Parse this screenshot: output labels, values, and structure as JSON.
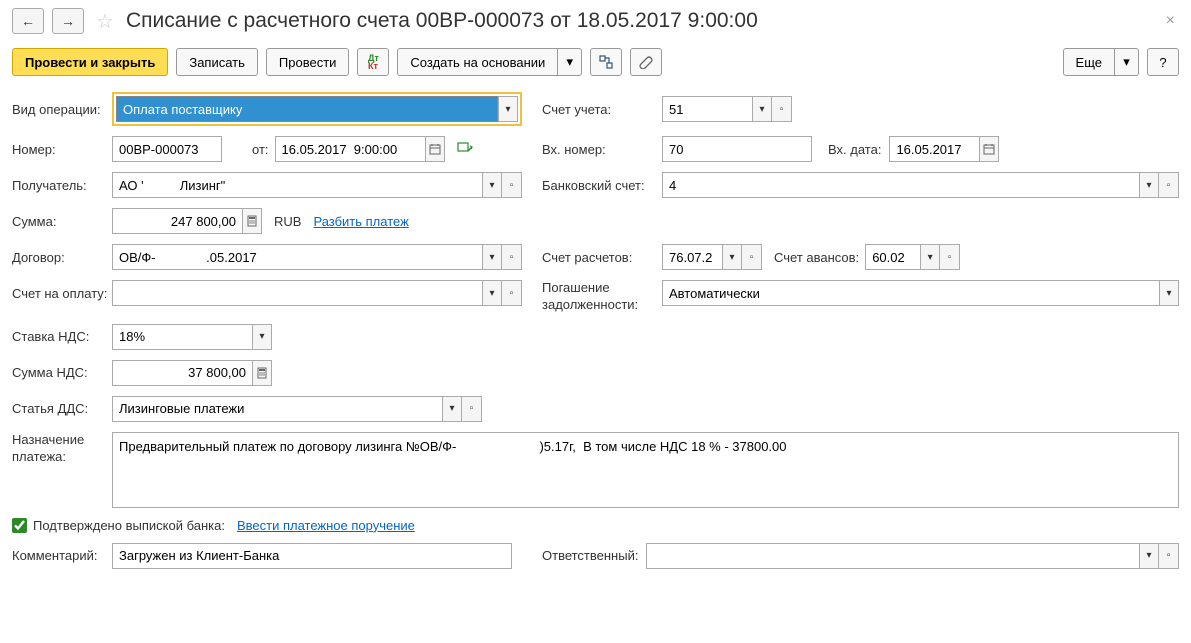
{
  "header": {
    "title": "Списание с расчетного счета 00ВР-000073 от 18.05.2017 9:00:00"
  },
  "toolbar": {
    "postClose": "Провести и закрыть",
    "save": "Записать",
    "post": "Провести",
    "createBased": "Создать на основании",
    "more": "Еще",
    "help": "?"
  },
  "labels": {
    "opType": "Вид операции:",
    "account": "Счет учета:",
    "number": "Номер:",
    "from": "от:",
    "inNumber": "Вх. номер:",
    "inDate": "Вх. дата:",
    "recipient": "Получатель:",
    "bankAccount": "Банковский счет:",
    "amount": "Сумма:",
    "currency": "RUB",
    "splitPayment": "Разбить платеж",
    "contract": "Договор:",
    "settlementAcc": "Счет расчетов:",
    "advanceAcc": "Счет авансов:",
    "invoice": "Счет на оплату:",
    "debtRepayment": "Погашение задолженности:",
    "vatRate": "Ставка НДС:",
    "vatAmount": "Сумма НДС:",
    "ddsArticle": "Статья ДДС:",
    "paymentPurpose": "Назначение платежа:",
    "confirmedByBank": "Подтверждено выпиской банка:",
    "enterPaymentOrder": "Ввести платежное поручение",
    "comment": "Комментарий:",
    "responsible": "Ответственный:"
  },
  "values": {
    "opType": "Оплата поставщику",
    "account": "51",
    "number": "00ВР-000073",
    "date": "16.05.2017  9:00:00",
    "inNumber": "70",
    "inDate": "16.05.2017",
    "recipient": "АО '          Лизинг\"",
    "bankAccount": "4",
    "amount": "247 800,00",
    "contract": "ОВ/Ф-              .05.2017",
    "settlementAcc": "76.07.2",
    "advanceAcc": "60.02",
    "invoice": "",
    "debtRepayment": "Автоматически",
    "vatRate": "18%",
    "vatAmount": "37 800,00",
    "ddsArticle": "Лизинговые платежи",
    "paymentPurpose": "Предварительный платеж по договору лизинга №ОВ/Ф-                       )5.17г,  В том числе НДС 18 % - 37800.00",
    "comment": "Загружен из Клиент-Банка",
    "responsible": ""
  }
}
